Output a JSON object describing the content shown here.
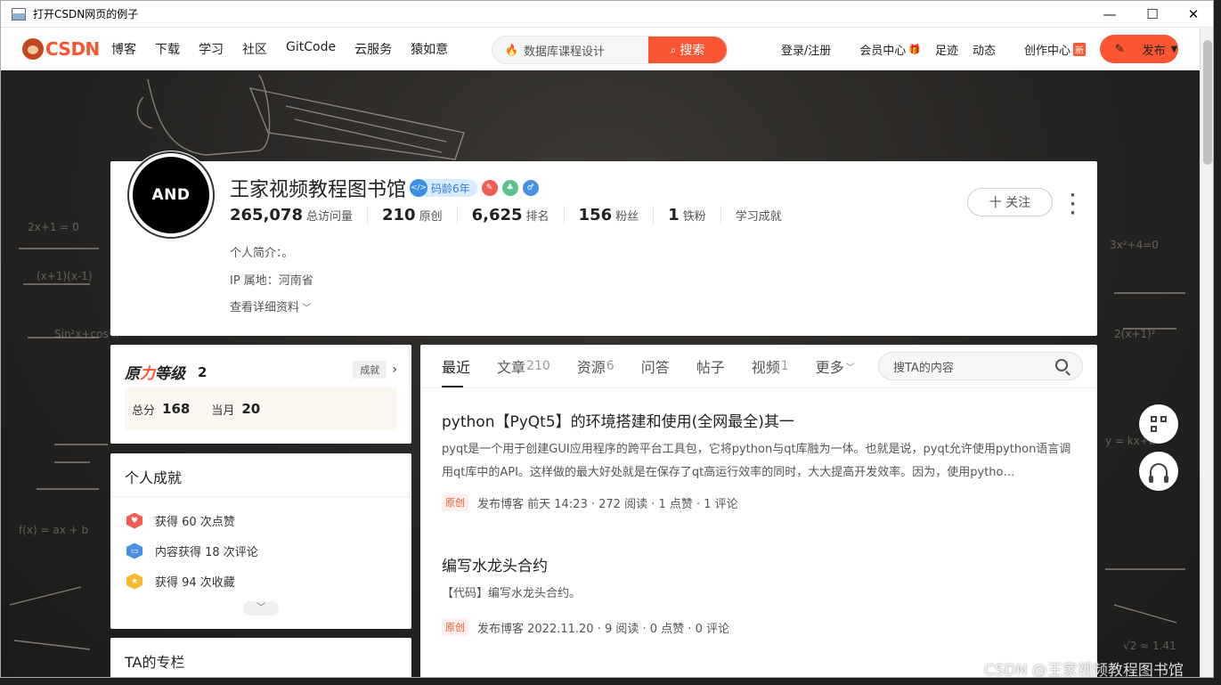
{
  "window": {
    "title": "打开CSDN网页的例子",
    "minimize": "—",
    "maximize": "☐",
    "close": "✕"
  },
  "nav": {
    "logo_text": "CSDN",
    "links": [
      "博客",
      "下载",
      "学习",
      "社区",
      "GitCode",
      "云服务",
      "猿如意"
    ],
    "search_placeholder": "数据库课程设计",
    "search_button": "搜索",
    "right_links": [
      "登录/注册",
      "会员中心",
      "足迹",
      "动态",
      "创作中心"
    ],
    "new_badge": "新",
    "publish": "发布"
  },
  "profile": {
    "avatar_text": "AND",
    "name": "王家视频教程图书馆",
    "code_age": "码龄6年",
    "stats": [
      {
        "num": "265,078",
        "label": "总访问量"
      },
      {
        "num": "210",
        "label": "原创"
      },
      {
        "num": "6,625",
        "label": "排名"
      },
      {
        "num": "156",
        "label": "粉丝"
      },
      {
        "num": "1",
        "label": "铁粉"
      },
      {
        "num": "",
        "label": "学习成就"
      }
    ],
    "intro": "个人简介：。",
    "ip": "IP 属地：河南省",
    "details": "查看详细资料",
    "follow": "十 关注"
  },
  "level_card": {
    "title_a": "原",
    "title_b": "力",
    "title_c": "等级",
    "level": "2",
    "achievements_tag": "成就",
    "total_label": "总分",
    "total_value": "168",
    "month_label": "当月",
    "month_value": "20"
  },
  "achievements": {
    "title": "个人成就",
    "items": [
      {
        "text": "获得 60 次点赞",
        "color": "#f25c54"
      },
      {
        "text": "内容获得 18 次评论",
        "color": "#4a90e2"
      },
      {
        "text": "获得 94 次收藏",
        "color": "#f5b82e"
      }
    ]
  },
  "column": {
    "title": "TA的专栏"
  },
  "tabs": [
    {
      "label": "最近",
      "count": ""
    },
    {
      "label": "文章",
      "count": "210"
    },
    {
      "label": "资源",
      "count": "6"
    },
    {
      "label": "问答",
      "count": ""
    },
    {
      "label": "帖子",
      "count": ""
    },
    {
      "label": "视频",
      "count": "1"
    },
    {
      "label": "更多",
      "count": ""
    }
  ],
  "tab_search_placeholder": "搜TA的内容",
  "articles": [
    {
      "title": "python【PyQt5】的环境搭建和使用(全网最全)其一",
      "desc": "pyqt是一个用于创建GUI应用程序的跨平台工具包，它将python与qt库融为一体。也就是说，pyqt允许使用python语言调用qt库中的API。这样做的最大好处就是在保存了qt高运行效率的同时，大大提高开发效率。因为，使用pytho…",
      "tag": "原创",
      "meta": "发布博客 前天 14:23 · 272 阅读 · 1 点赞 · 1 评论"
    },
    {
      "title": "编写水龙头合约",
      "desc": "【代码】编写水龙头合约。",
      "tag": "原创",
      "meta": "发布博客 2022.11.20 · 9 阅读 · 0 点赞 · 0 评论"
    }
  ],
  "watermark": "CSDN @王家视频教程图书馆",
  "colors": {
    "accent": "#fc5531"
  }
}
